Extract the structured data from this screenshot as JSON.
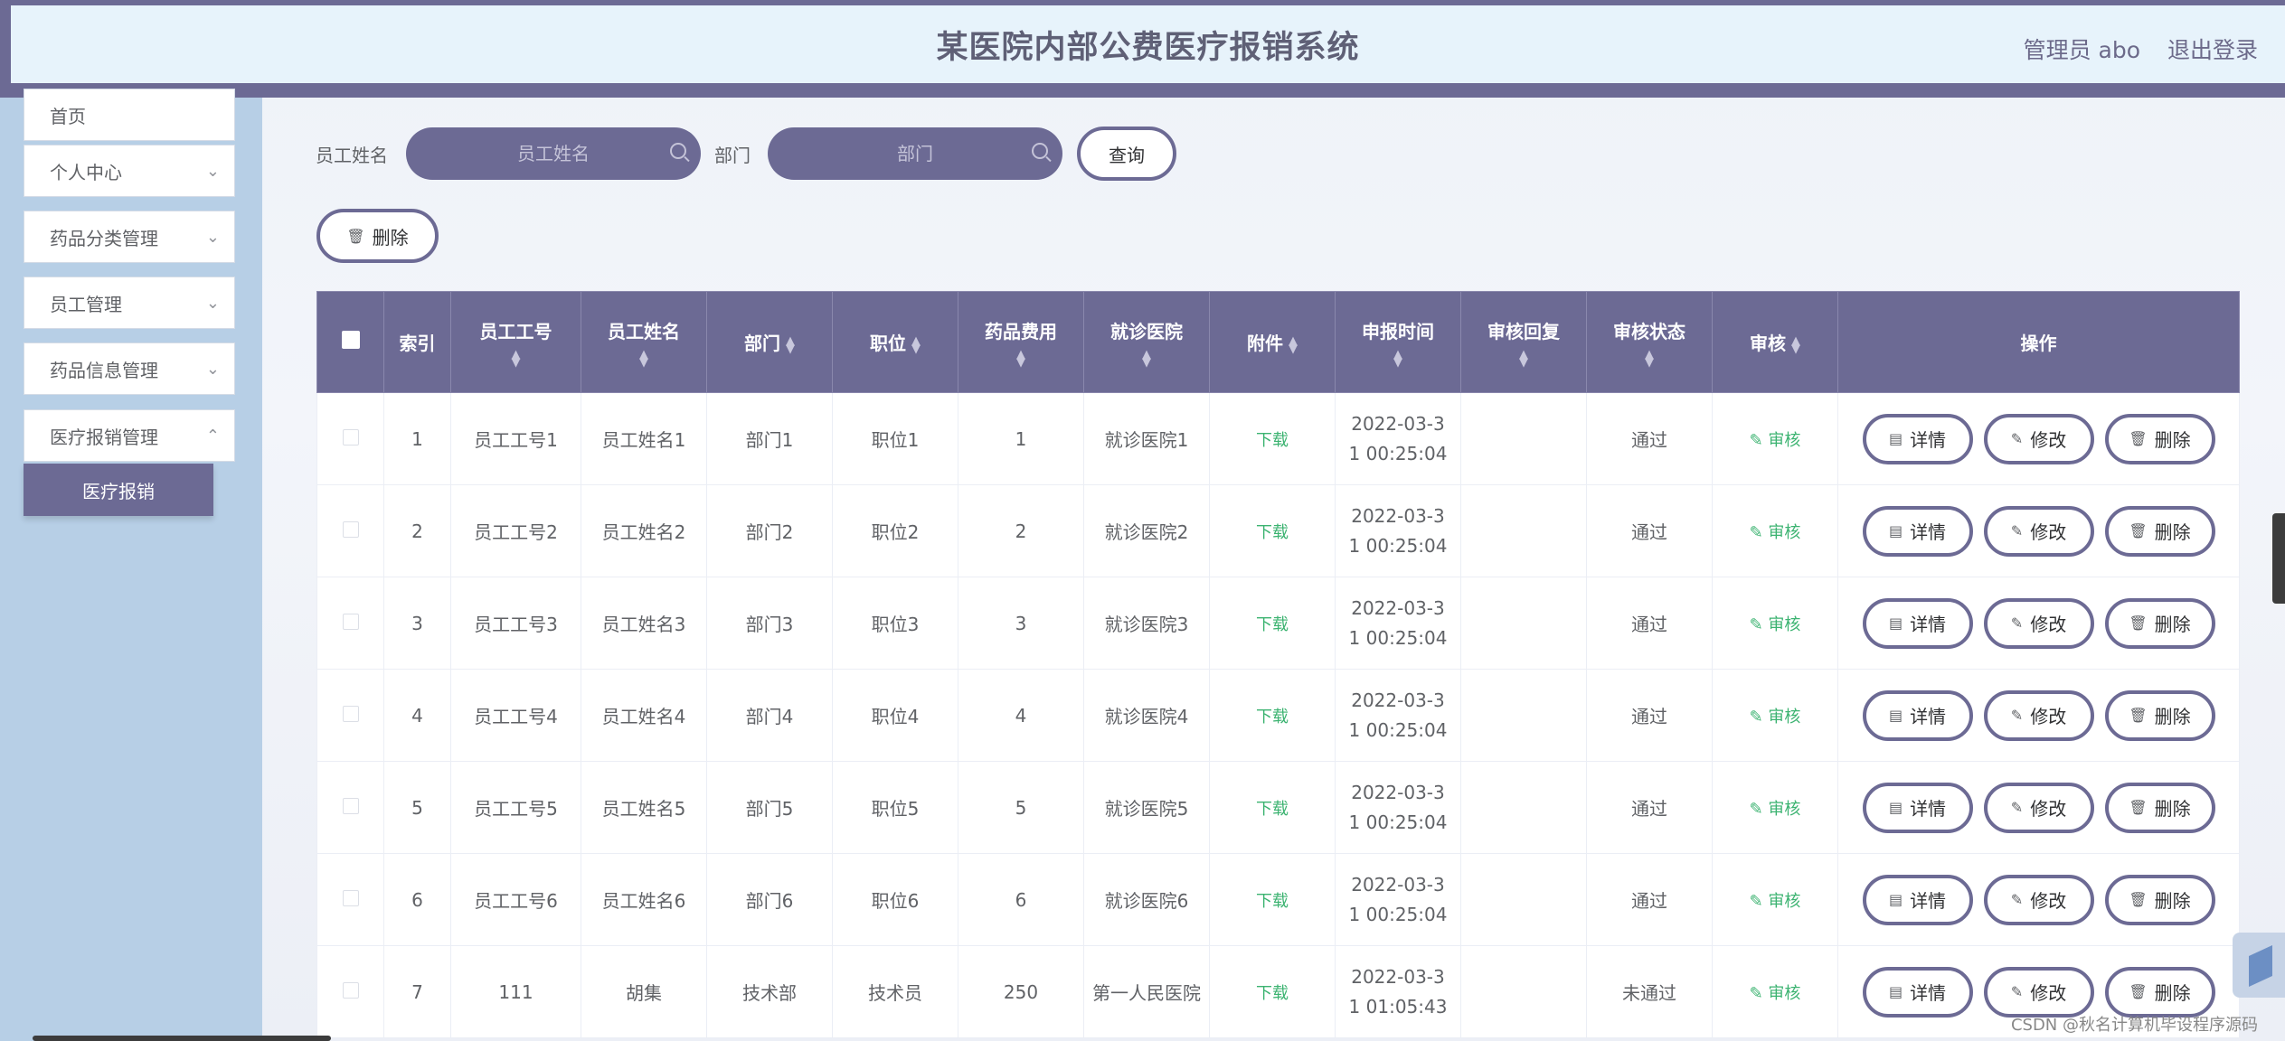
{
  "header": {
    "title": "某医院内部公费医疗报销系统",
    "user": "管理员 abo",
    "logout": "退出登录"
  },
  "sidebar": {
    "items": [
      {
        "label": "首页"
      },
      {
        "label": "个人中心"
      },
      {
        "label": "药品分类管理"
      },
      {
        "label": "员工管理"
      },
      {
        "label": "药品信息管理"
      },
      {
        "label": "医疗报销管理"
      }
    ],
    "active_sub": "医疗报销"
  },
  "search": {
    "name_label": "员工姓名",
    "name_placeholder": "员工姓名",
    "dept_label": "部门",
    "dept_placeholder": "部门",
    "query_button": "查询"
  },
  "toolbar": {
    "delete_button": "删除"
  },
  "table": {
    "columns": [
      "索引",
      "员工工号",
      "员工姓名",
      "部门",
      "职位",
      "药品费用",
      "就诊医院",
      "附件",
      "申报时间",
      "审核回复",
      "审核状态",
      "审核",
      "操作"
    ],
    "rows": [
      {
        "index": "1",
        "emp_no": "员工工号1",
        "name": "员工姓名1",
        "dept": "部门1",
        "position": "职位1",
        "cost": "1",
        "hospital": "就诊医院1",
        "attachment": "下载",
        "time_a": "2022-03-3",
        "time_b": "1 00:25:04",
        "reply": "",
        "status": "通过",
        "audit": "审核"
      },
      {
        "index": "2",
        "emp_no": "员工工号2",
        "name": "员工姓名2",
        "dept": "部门2",
        "position": "职位2",
        "cost": "2",
        "hospital": "就诊医院2",
        "attachment": "下载",
        "time_a": "2022-03-3",
        "time_b": "1 00:25:04",
        "reply": "",
        "status": "通过",
        "audit": "审核"
      },
      {
        "index": "3",
        "emp_no": "员工工号3",
        "name": "员工姓名3",
        "dept": "部门3",
        "position": "职位3",
        "cost": "3",
        "hospital": "就诊医院3",
        "attachment": "下载",
        "time_a": "2022-03-3",
        "time_b": "1 00:25:04",
        "reply": "",
        "status": "通过",
        "audit": "审核"
      },
      {
        "index": "4",
        "emp_no": "员工工号4",
        "name": "员工姓名4",
        "dept": "部门4",
        "position": "职位4",
        "cost": "4",
        "hospital": "就诊医院4",
        "attachment": "下载",
        "time_a": "2022-03-3",
        "time_b": "1 00:25:04",
        "reply": "",
        "status": "通过",
        "audit": "审核"
      },
      {
        "index": "5",
        "emp_no": "员工工号5",
        "name": "员工姓名5",
        "dept": "部门5",
        "position": "职位5",
        "cost": "5",
        "hospital": "就诊医院5",
        "attachment": "下载",
        "time_a": "2022-03-3",
        "time_b": "1 00:25:04",
        "reply": "",
        "status": "通过",
        "audit": "审核"
      },
      {
        "index": "6",
        "emp_no": "员工工号6",
        "name": "员工姓名6",
        "dept": "部门6",
        "position": "职位6",
        "cost": "6",
        "hospital": "就诊医院6",
        "attachment": "下载",
        "time_a": "2022-03-3",
        "time_b": "1 00:25:04",
        "reply": "",
        "status": "通过",
        "audit": "审核"
      },
      {
        "index": "7",
        "emp_no": "111",
        "name": "胡集",
        "dept": "技术部",
        "position": "技术员",
        "cost": "250",
        "hospital": "第一人民医院",
        "attachment": "下载",
        "time_a": "2022-03-3",
        "time_b": "1 01:05:43",
        "reply": "",
        "status": "未通过",
        "audit": "审核"
      }
    ],
    "op_labels": {
      "detail": "详情",
      "edit": "修改",
      "delete": "删除"
    }
  },
  "watermark": "CSDN @秋名计算机毕设程序源码"
}
